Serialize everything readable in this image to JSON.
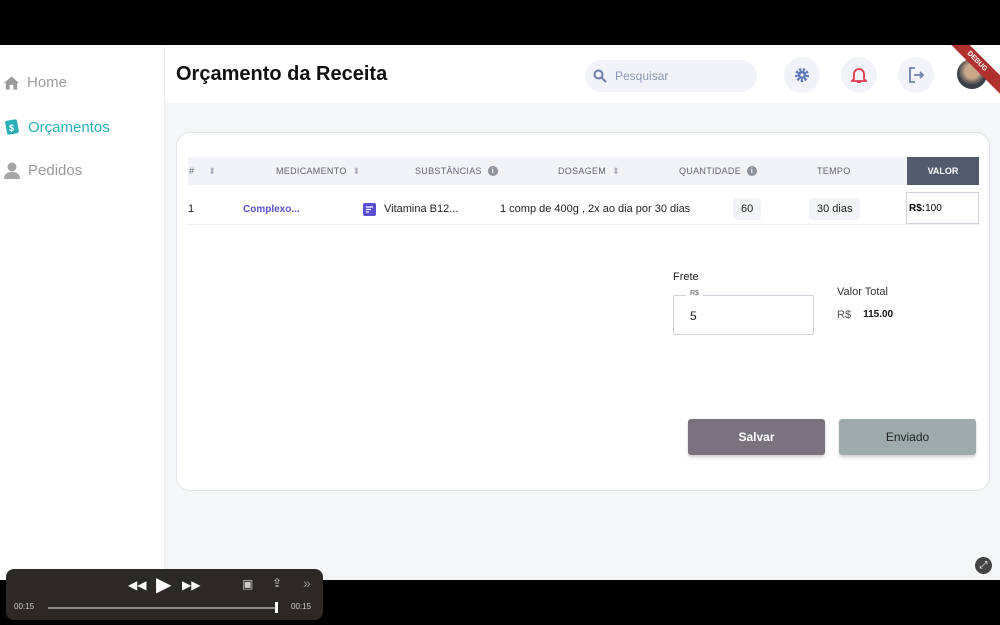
{
  "sidebar": {
    "items": [
      {
        "label": "Home",
        "icon": "home-icon"
      },
      {
        "label": "Orçamentos",
        "icon": "budget-icon",
        "active": true
      },
      {
        "label": "Pedidos",
        "icon": "person-icon"
      }
    ]
  },
  "header": {
    "title": "Orçamento da Receita",
    "search_placeholder": "Pesquisar",
    "debug_banner": "DEBUG"
  },
  "table": {
    "headers": {
      "num": "#",
      "medicamento": "MEDICAMENTO",
      "substancias": "SUBSTÂNCIAS",
      "dosagem": "DOSAGEM",
      "quantidade": "QUANTIDADE",
      "tempo": "TEMPO",
      "valor": "VALOR"
    },
    "rows": [
      {
        "num": "1",
        "medicamento": "Complexo...",
        "substancias": "Vitamina B12...",
        "dosagem": "1 comp de 400g , 2x ao dia por 30 dias",
        "quantidade": "60",
        "tempo": "30 dias",
        "valor_prefix": "R$:",
        "valor": "100"
      }
    ]
  },
  "frete": {
    "label": "Frete",
    "currency": "R$",
    "value": "5"
  },
  "total": {
    "label": "Valor Total",
    "currency": "R$",
    "value": "115.00"
  },
  "buttons": {
    "salvar": "Salvar",
    "enviado": "Enviado"
  },
  "colors": {
    "accent": "#2ab0b8",
    "link": "#5a4fcf",
    "salvar": "#7a727f",
    "enviado": "#9fabab",
    "header_valor": "#545a6e"
  },
  "player": {
    "current": "00:15",
    "duration": "00:15",
    "progress": 1.0
  }
}
